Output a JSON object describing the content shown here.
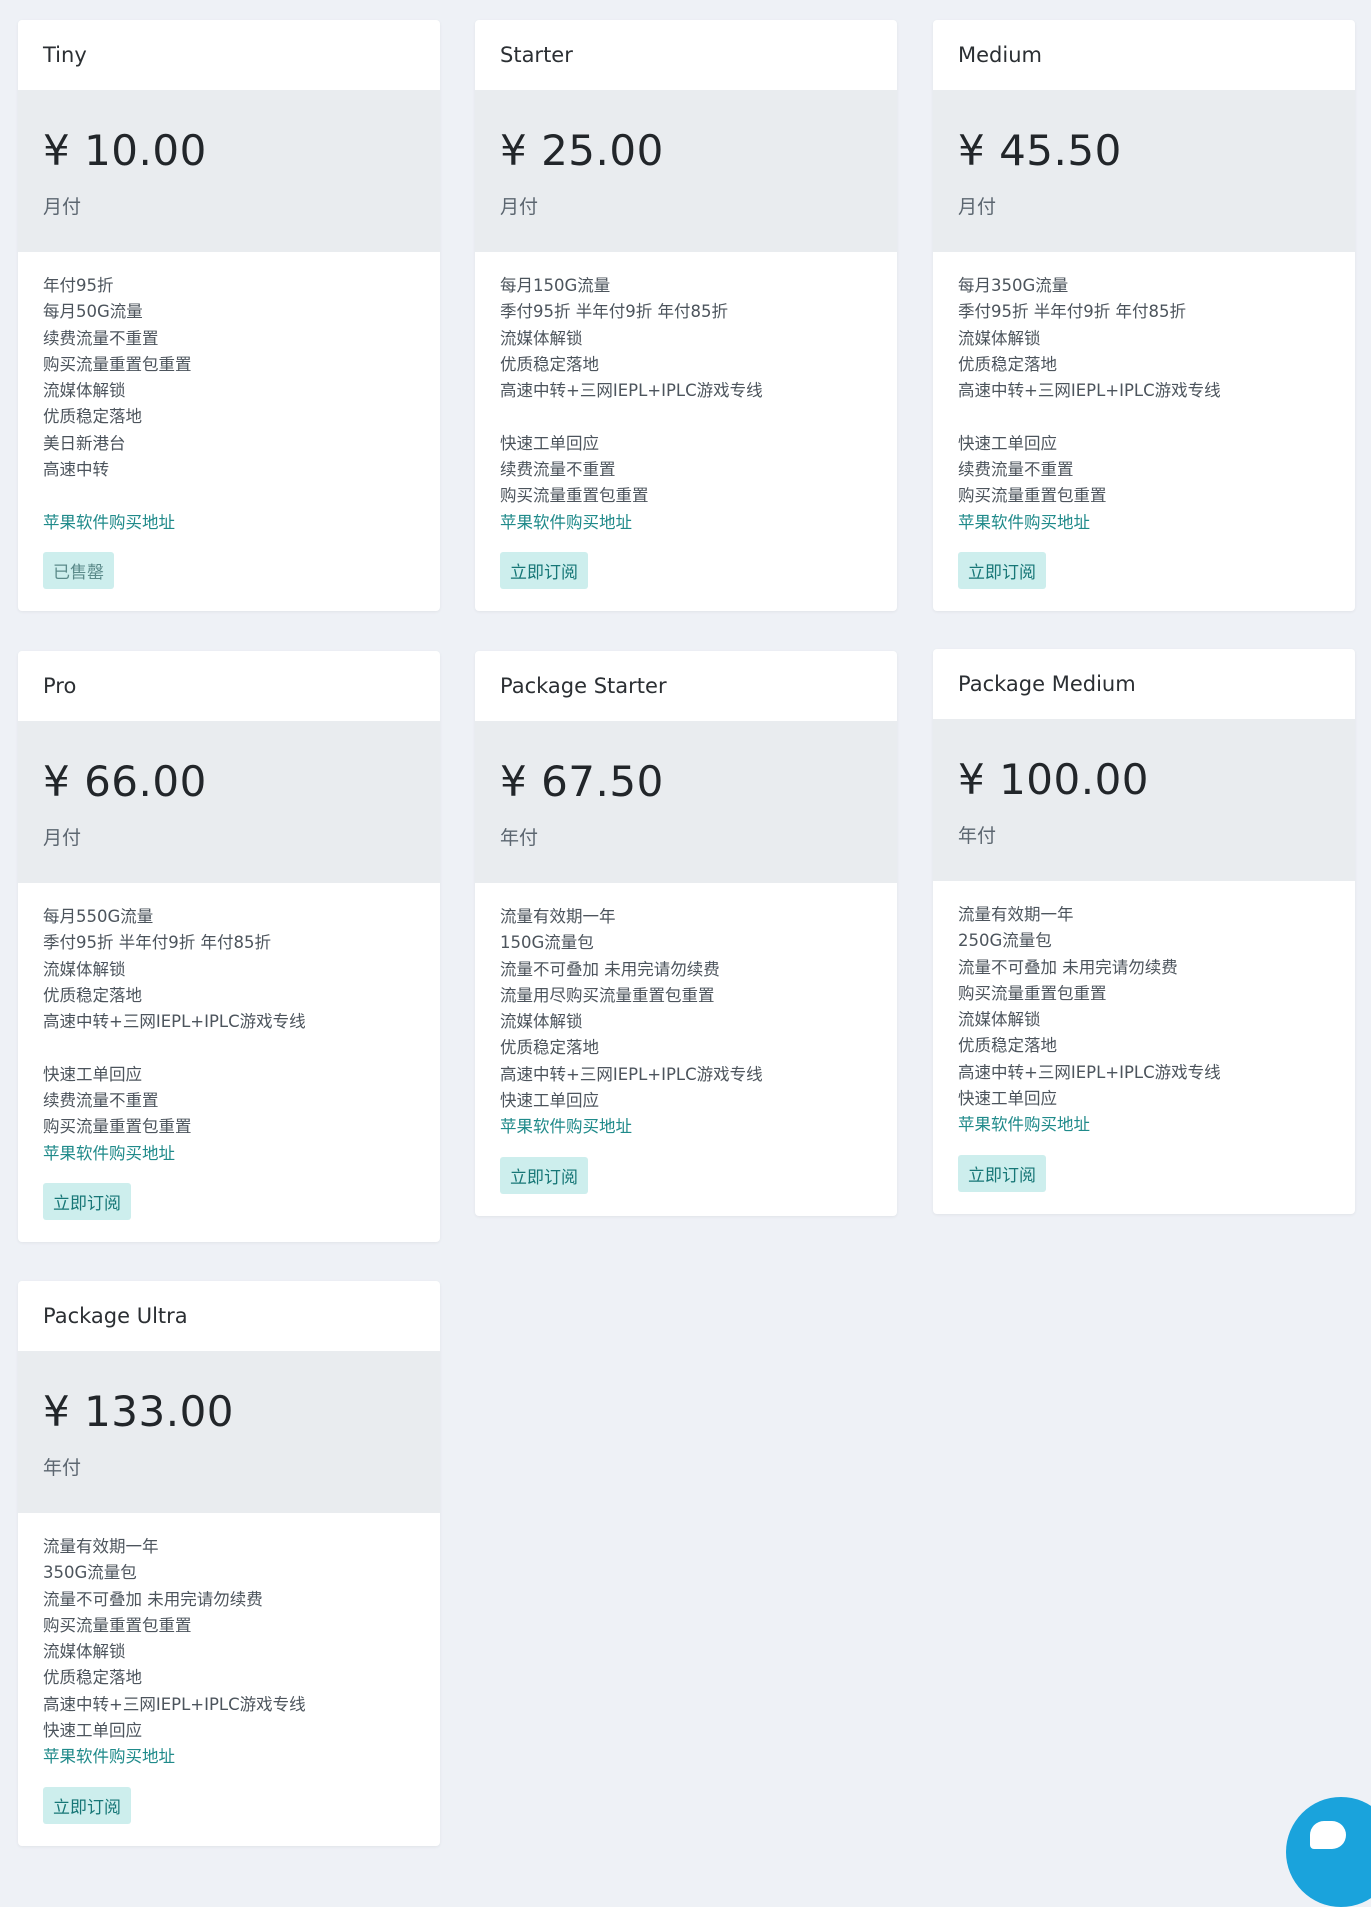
{
  "plans": [
    {
      "title": "Tiny",
      "price": "¥ 10.00",
      "period": "月付",
      "features": [
        "年付95折",
        "每月50G流量",
        "续费流量不重置",
        "购买流量重置包重置",
        "流媒体解锁",
        "优质稳定落地",
        "美日新港台",
        "高速中转",
        ""
      ],
      "link": "苹果软件购买地址",
      "button": "已售罄"
    },
    {
      "title": "Starter",
      "price": "¥ 25.00",
      "period": "月付",
      "features": [
        "每月150G流量",
        "季付95折 半年付9折 年付85折",
        "流媒体解锁",
        "优质稳定落地",
        "高速中转+三网IEPL+IPLC游戏专线",
        "",
        "快速工单回应",
        "续费流量不重置",
        "购买流量重置包重置"
      ],
      "link": "苹果软件购买地址",
      "button": "立即订阅"
    },
    {
      "title": "Medium",
      "price": "¥ 45.50",
      "period": "月付",
      "features": [
        "每月350G流量",
        "季付95折 半年付9折 年付85折",
        "流媒体解锁",
        "优质稳定落地",
        "高速中转+三网IEPL+IPLC游戏专线",
        "",
        "快速工单回应",
        "续费流量不重置",
        "购买流量重置包重置"
      ],
      "link": "苹果软件购买地址",
      "button": "立即订阅"
    },
    {
      "title": "Pro",
      "price": "¥ 66.00",
      "period": "月付",
      "features": [
        "每月550G流量",
        "季付95折 半年付9折 年付85折",
        "流媒体解锁",
        "优质稳定落地",
        "高速中转+三网IEPL+IPLC游戏专线",
        "",
        "快速工单回应",
        "续费流量不重置",
        "购买流量重置包重置"
      ],
      "link": "苹果软件购买地址",
      "button": "立即订阅"
    },
    {
      "title": "Package Starter",
      "price": "¥ 67.50",
      "period": "年付",
      "features": [
        "流量有效期一年",
        "150G流量包",
        "流量不可叠加 未用完请勿续费",
        "流量用尽购买流量重置包重置",
        "流媒体解锁",
        "优质稳定落地",
        "高速中转+三网IEPL+IPLC游戏专线",
        "快速工单回应"
      ],
      "link": "苹果软件购买地址",
      "button": "立即订阅"
    },
    {
      "title": "Package Medium",
      "price": "¥ 100.00",
      "period": "年付",
      "features": [
        "流量有效期一年",
        "250G流量包",
        "流量不可叠加 未用完请勿续费",
        "购买流量重置包重置",
        "流媒体解锁",
        "优质稳定落地",
        "高速中转+三网IEPL+IPLC游戏专线",
        "快速工单回应"
      ],
      "link": "苹果软件购买地址",
      "button": "立即订阅"
    },
    {
      "title": "Package Ultra",
      "price": "¥ 133.00",
      "period": "年付",
      "features": [
        "流量有效期一年",
        "350G流量包",
        "流量不可叠加 未用完请勿续费",
        "购买流量重置包重置",
        "流媒体解锁",
        "优质稳定落地",
        "高速中转+三网IEPL+IPLC游戏专线",
        "快速工单回应"
      ],
      "link": "苹果软件购买地址",
      "button": "立即订阅"
    }
  ],
  "colors": {
    "page_bg": "#eef1f6",
    "card_bg": "#ffffff",
    "price_bg": "#e9ecef",
    "link": "#1f8a8a",
    "button_bg": "#cdeeed",
    "chat_bubble": "#1aa3dc"
  },
  "chat_icon": "chat-bubble-icon"
}
